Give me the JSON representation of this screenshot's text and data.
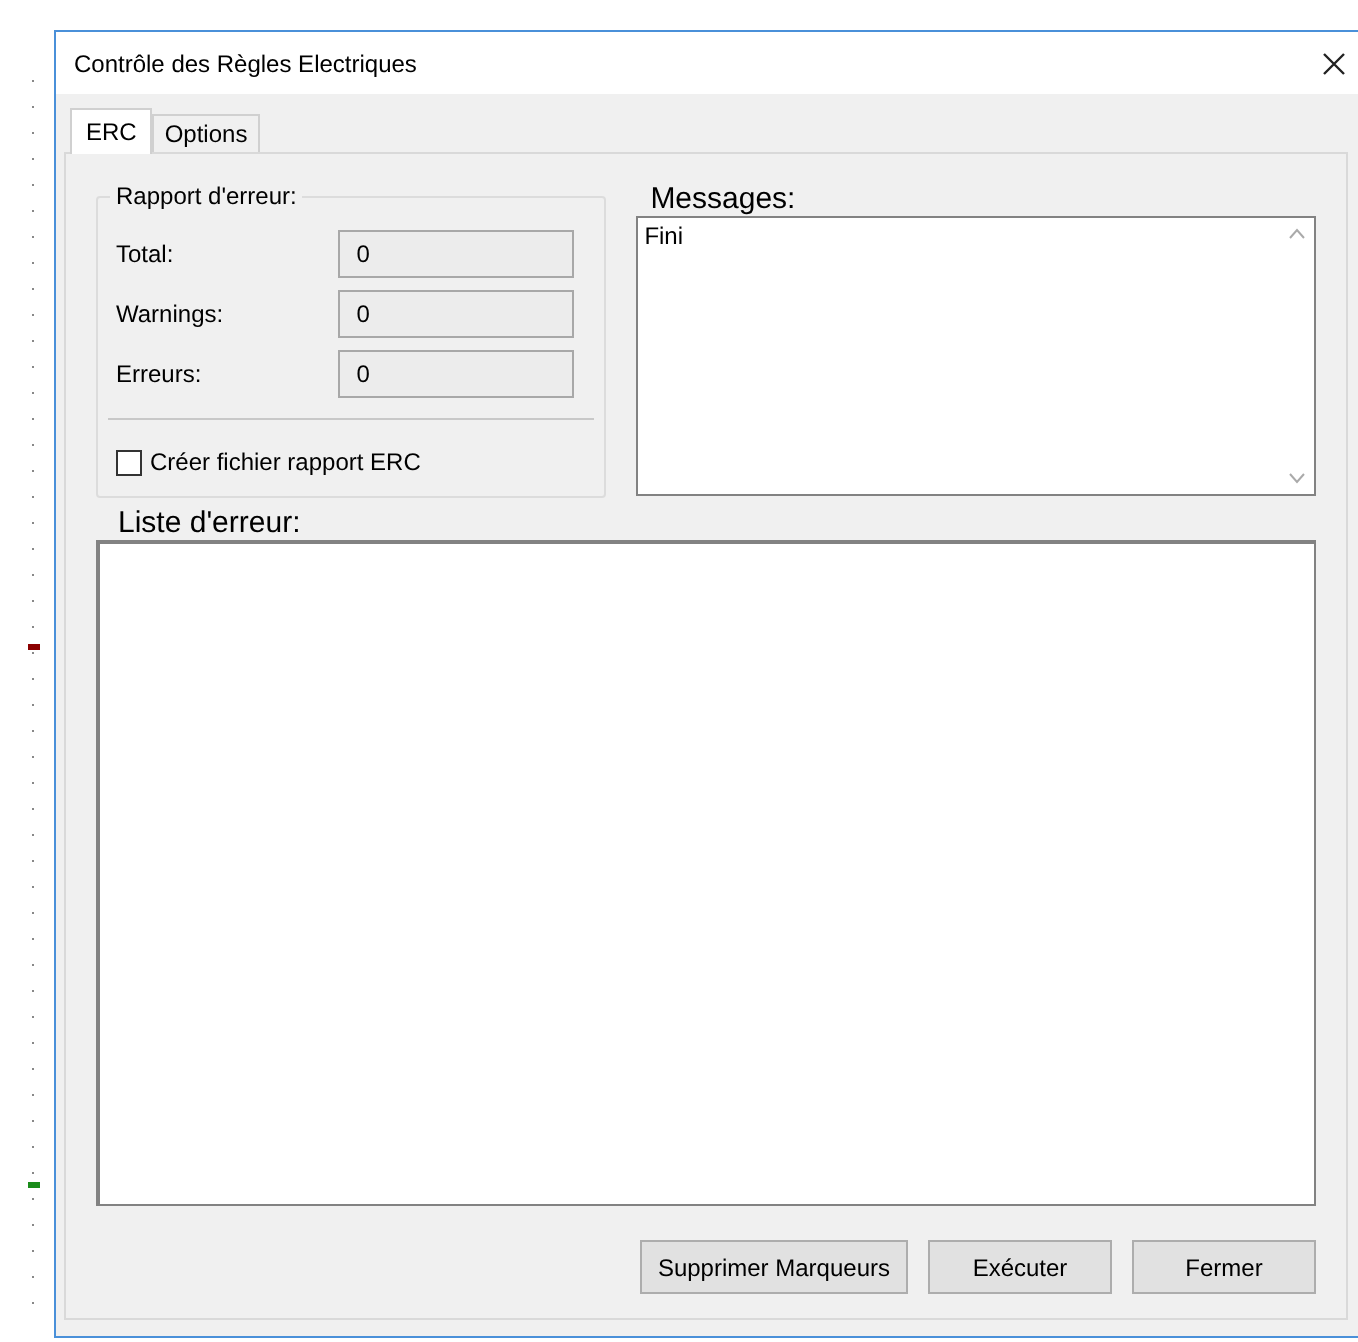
{
  "window": {
    "title": "Contrôle des Règles Electriques"
  },
  "tabs": [
    {
      "label": "ERC",
      "selected": true
    },
    {
      "label": "Options",
      "selected": false
    }
  ],
  "report": {
    "title": "Rapport d'erreur:",
    "fields": [
      {
        "label": "Total:",
        "value": "0"
      },
      {
        "label": "Warnings:",
        "value": "0"
      },
      {
        "label": "Erreurs:",
        "value": "0"
      }
    ],
    "checkbox": {
      "label": "Créer fichier rapport ERC",
      "checked": false
    }
  },
  "messages": {
    "label": "Messages:",
    "text": "Fini"
  },
  "error_list": {
    "label": "Liste d'erreur:"
  },
  "buttons": [
    "Supprimer Marqueurs",
    "Exécuter",
    "Fermer"
  ]
}
